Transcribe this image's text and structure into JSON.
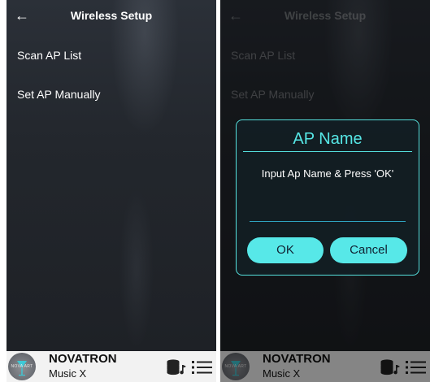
{
  "left_screen": {
    "header": {
      "back_icon": "arrow-left",
      "title": "Wireless Setup"
    },
    "menu_items": [
      {
        "label": "Scan AP List"
      },
      {
        "label": "Set AP Manually"
      }
    ],
    "now_playing": {
      "logo_text": "NOVA ART",
      "brand": "NOVATRON",
      "subtitle": "Music X"
    }
  },
  "right_screen": {
    "header": {
      "back_icon": "arrow-left",
      "title": "Wireless Setup"
    },
    "menu_items": [
      {
        "label": "Scan AP List"
      },
      {
        "label": "Set AP Manually"
      }
    ],
    "dialog": {
      "title": "AP Name",
      "message": "Input Ap Name & Press 'OK'",
      "input_value": "",
      "ok_label": "OK",
      "cancel_label": "Cancel",
      "accent": "#56e7e6"
    },
    "now_playing": {
      "logo_text": "NOVA ART",
      "brand": "NOVATRON",
      "subtitle": "Music X"
    }
  },
  "icons": {
    "db": "database-music-icon",
    "menu": "list-menu-icon"
  }
}
